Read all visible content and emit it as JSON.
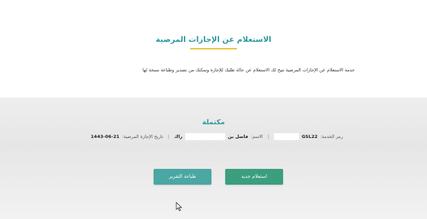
{
  "header": {
    "title": "الاستعلام عن الإجازات المرضية",
    "description": "خدمة الاستعلام عن الإجازات المرضية تتيح لك الاستعلام عن حالة طلبك للإجازة وتمكنك من تصدير وطباعة نسخة لها"
  },
  "result": {
    "status": "مكتملة",
    "service_code_label": "رمز الخدمة:",
    "service_code_value": "GSL22",
    "name_label": "الاسم:",
    "name_value_start": "فاضل بن",
    "name_value_end": "راك",
    "leave_date_label": "تاريخ الإجازة المرضية:",
    "leave_date_value": "1443-06-21"
  },
  "actions": {
    "new_inquiry_label": "استعلام جديد",
    "print_report_label": "طباعة التقرير"
  },
  "colors": {
    "accent": "#2e9aa0",
    "underline": "#e9c23a",
    "new_button": "#3a9e7f",
    "print_button": "#4aa7a4"
  },
  "icons": {
    "cursor": "mouse-pointer-icon"
  }
}
